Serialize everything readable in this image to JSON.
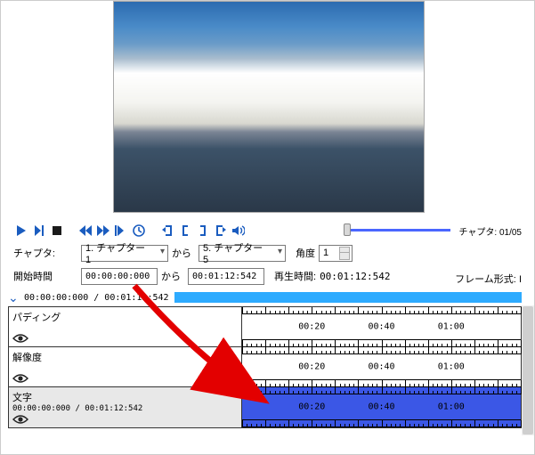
{
  "icons": {
    "play": "play-icon",
    "step_fwd": "step-forward-icon",
    "stop": "stop-icon",
    "rewind": "rewind-icon",
    "ffwd": "fast-forward-icon",
    "step_slow": "step-slow-icon",
    "clock": "clock-icon",
    "mark_in": "mark-in-icon",
    "mark_left": "mark-left-icon",
    "mark_right": "mark-right-icon",
    "mark_out": "mark-out-icon",
    "volume": "volume-icon",
    "eye": "eye-icon"
  },
  "chapter_count": "チャプタ: 01/05",
  "row1": {
    "label": "チャプタ:",
    "from_sel": "1. チャプター 1",
    "kara1": "から",
    "to_sel": "5. チャプター 5",
    "angle_lbl": "角度",
    "angle_val": "1"
  },
  "row2": {
    "label": "開始時間",
    "start": "00:00:00:000",
    "kara2": "から",
    "end": "00:01:12:542",
    "play_lbl": "再生時間:",
    "play_val": "00:01:12:542",
    "frame_lbl": "フレーム形式:",
    "frame_val": "I"
  },
  "timeline_header": "00:00:00:000 / 00:01:12:542",
  "tracks": [
    {
      "name": "パディング",
      "sub": "",
      "selected": false
    },
    {
      "name": "解像度",
      "sub": "",
      "selected": false
    },
    {
      "name": "文字",
      "sub": "00:00:00:000 / 00:01:12:542",
      "selected": true
    }
  ],
  "tick_labels": [
    "00:20",
    "00:40",
    "01:00"
  ],
  "colors": {
    "accent": "#1a5cbf",
    "timeline_fill": "#3b57e6",
    "header_bar": "#2dabff",
    "anno_arrow": "#e30000"
  }
}
